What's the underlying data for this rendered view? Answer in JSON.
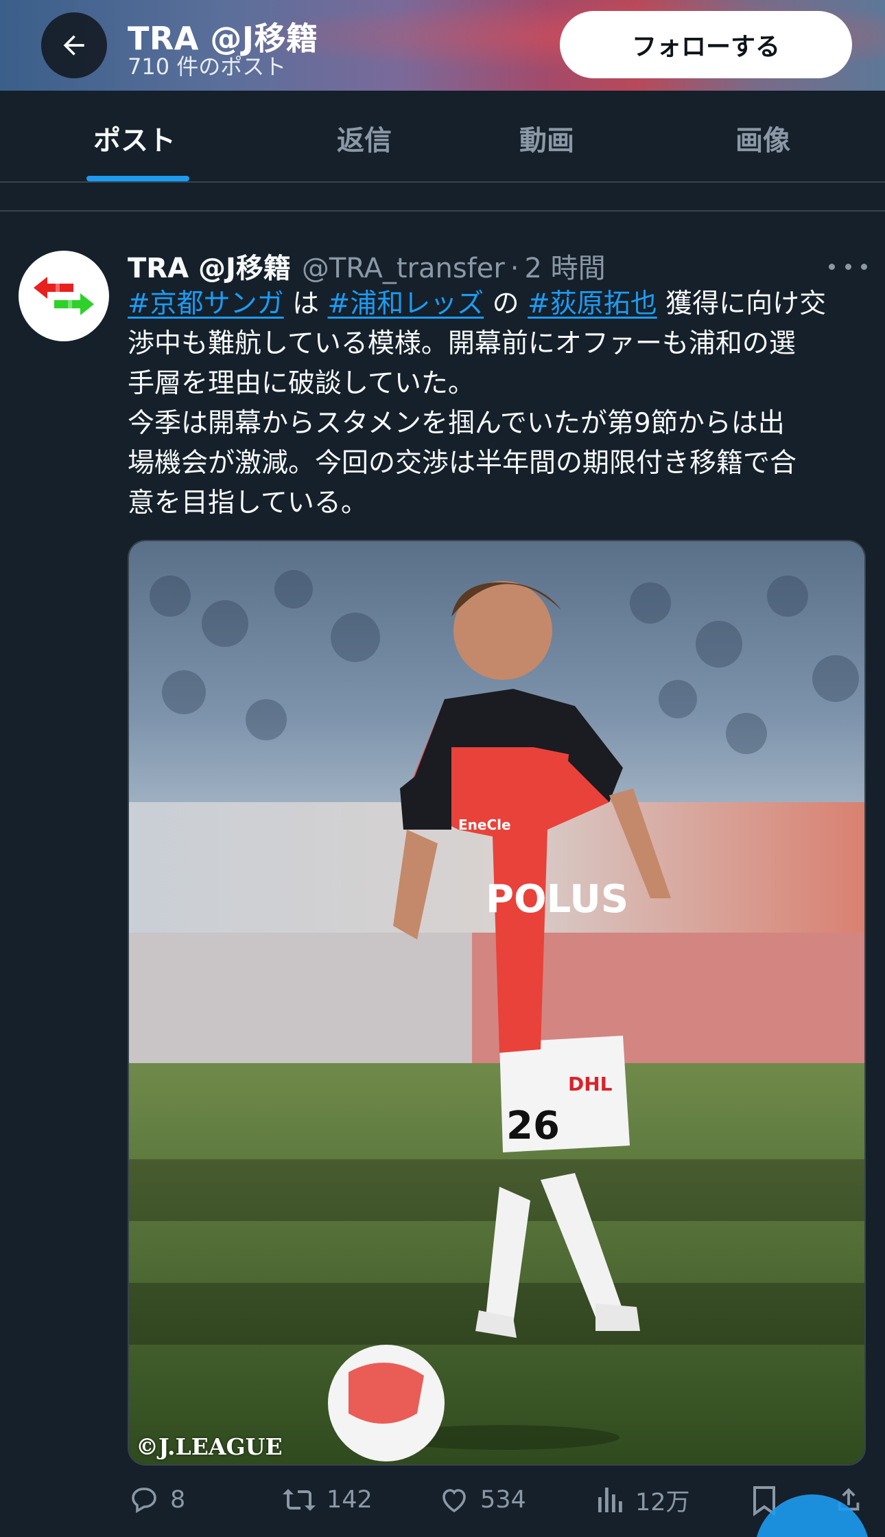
{
  "header": {
    "title": "TRA @J移籍",
    "post_count": "710 件のポスト",
    "follow_label": "フォローする"
  },
  "tabs": [
    {
      "label": "ポスト",
      "active": true
    },
    {
      "label": "返信",
      "active": false
    },
    {
      "label": "動画",
      "active": false
    },
    {
      "label": "画像",
      "active": false
    }
  ],
  "post": {
    "author_name": "TRA @J移籍",
    "handle": "@TRA_transfer",
    "separator": "·",
    "time": "2 時間",
    "tag1": "#京都サンガ",
    "text_wa": "は",
    "tag2": "#浦和レッズ",
    "text_no": "の",
    "tag3": "#荻原拓也",
    "line1_rest": "獲得に向け交",
    "line2": "渉中も難航している模様。開幕前にオファーも浦和の選",
    "line3": "手層を理由に破談していた。",
    "line4": "今季は開幕からスタメンを掴んでいたが第9節からは出",
    "line5": "場機会が激減。今回の交渉は半年間の期限付き移籍で合",
    "line6": "意を目指している。",
    "image_credit": "©J.LEAGUE",
    "jersey_sponsor": "POLUS",
    "jersey_brand": "EneCle",
    "shorts_sponsor": "DHL",
    "shorts_number": "26"
  },
  "actions": {
    "replies": "8",
    "reposts": "142",
    "likes": "534",
    "views": "12万"
  },
  "colors": {
    "background": "#15202b",
    "accent": "#1d9bf0",
    "muted": "#8b98a5"
  }
}
